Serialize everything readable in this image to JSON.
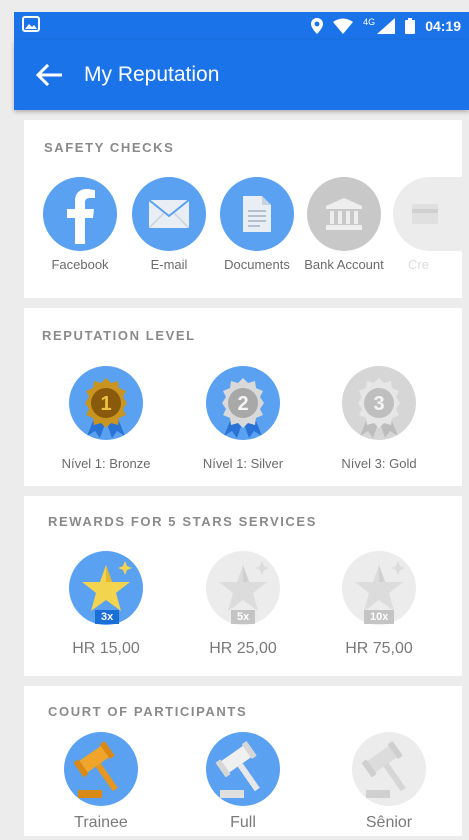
{
  "status": {
    "time": "04:19",
    "network": "4G"
  },
  "appbar": {
    "title": "My Reputation"
  },
  "safety": {
    "heading": "SAFETY CHECKS",
    "items": [
      {
        "label": "Facebook",
        "icon": "facebook-icon"
      },
      {
        "label": "E-mail",
        "icon": "envelope-icon"
      },
      {
        "label": "Documents",
        "icon": "document-icon"
      },
      {
        "label": "Bank Account",
        "icon": "bank-icon"
      },
      {
        "label": "Cre",
        "icon": "credit-card-icon"
      }
    ]
  },
  "reputation": {
    "heading": "REPUTATION LEVEL",
    "items": [
      {
        "label": "Nível 1: Bronze",
        "number": "1"
      },
      {
        "label": "Nível 1: Silver",
        "number": "2"
      },
      {
        "label": "Nível 3: Gold",
        "number": "3"
      }
    ]
  },
  "rewards": {
    "heading": "REWARDS FOR 5 STARS SERVICES",
    "items": [
      {
        "multiplier": "3x",
        "amount": "HR 15,00"
      },
      {
        "multiplier": "5x",
        "amount": "HR 25,00"
      },
      {
        "multiplier": "10x",
        "amount": "HR 75,00"
      }
    ]
  },
  "court": {
    "heading": "COURT OF PARTICIPANTS",
    "items": [
      {
        "label": "Trainee"
      },
      {
        "label": "Full"
      },
      {
        "label": "Sênior"
      }
    ]
  },
  "colors": {
    "primary": "#1a73e8",
    "accent_circle": "#5aa1f2",
    "inactive_circle": "#c8c8c8"
  }
}
